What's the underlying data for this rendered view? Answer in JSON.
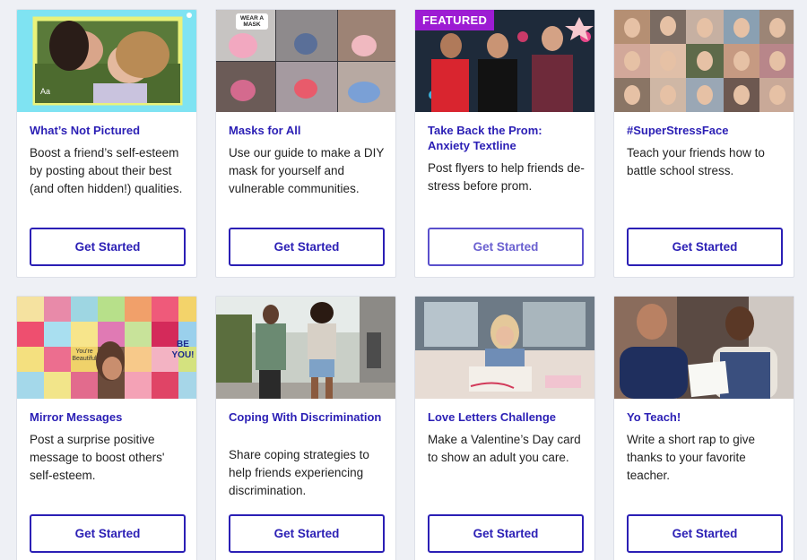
{
  "featured_label": "FEATURED",
  "cards": [
    {
      "title": "What’s Not Pictured",
      "desc": "Boost a friend’s self-esteem by posting about their best (and often hidden!) qualities.",
      "button": "Get Started"
    },
    {
      "title": "Masks for All",
      "desc": "Use our guide to make a DIY mask for yourself and vulnerable communities.",
      "button": "Get Started"
    },
    {
      "title": "Take Back the Prom: Anxiety Textline",
      "desc": "Post flyers to help friends de-stress before prom.",
      "button": "Get Started"
    },
    {
      "title": "#SuperStressFace",
      "desc": "Teach your friends how to battle school stress.",
      "button": "Get Started"
    },
    {
      "title": "Mirror Messages",
      "desc": "Post a surprise positive message to boost others' self-esteem.",
      "button": "Get Started"
    },
    {
      "title": "Coping With Discrimination",
      "desc": "Share coping strategies to help friends experiencing discrimination.",
      "button": "Get Started"
    },
    {
      "title": "Love Letters Challenge",
      "desc": "Make a Valentine’s Day card to show an adult you care.",
      "button": "Get Started"
    },
    {
      "title": "Yo Teach!",
      "desc": "Write a short rap to give thanks to your favorite teacher.",
      "button": "Get Started"
    }
  ],
  "image_text": {
    "aa": "Aa",
    "mask_sign": "WEAR A MASK",
    "note1": "BE YOU!",
    "note2": "You're Beautiful"
  },
  "colors": {
    "accent": "#2b1fb5",
    "featured": "#9d1cd3"
  }
}
